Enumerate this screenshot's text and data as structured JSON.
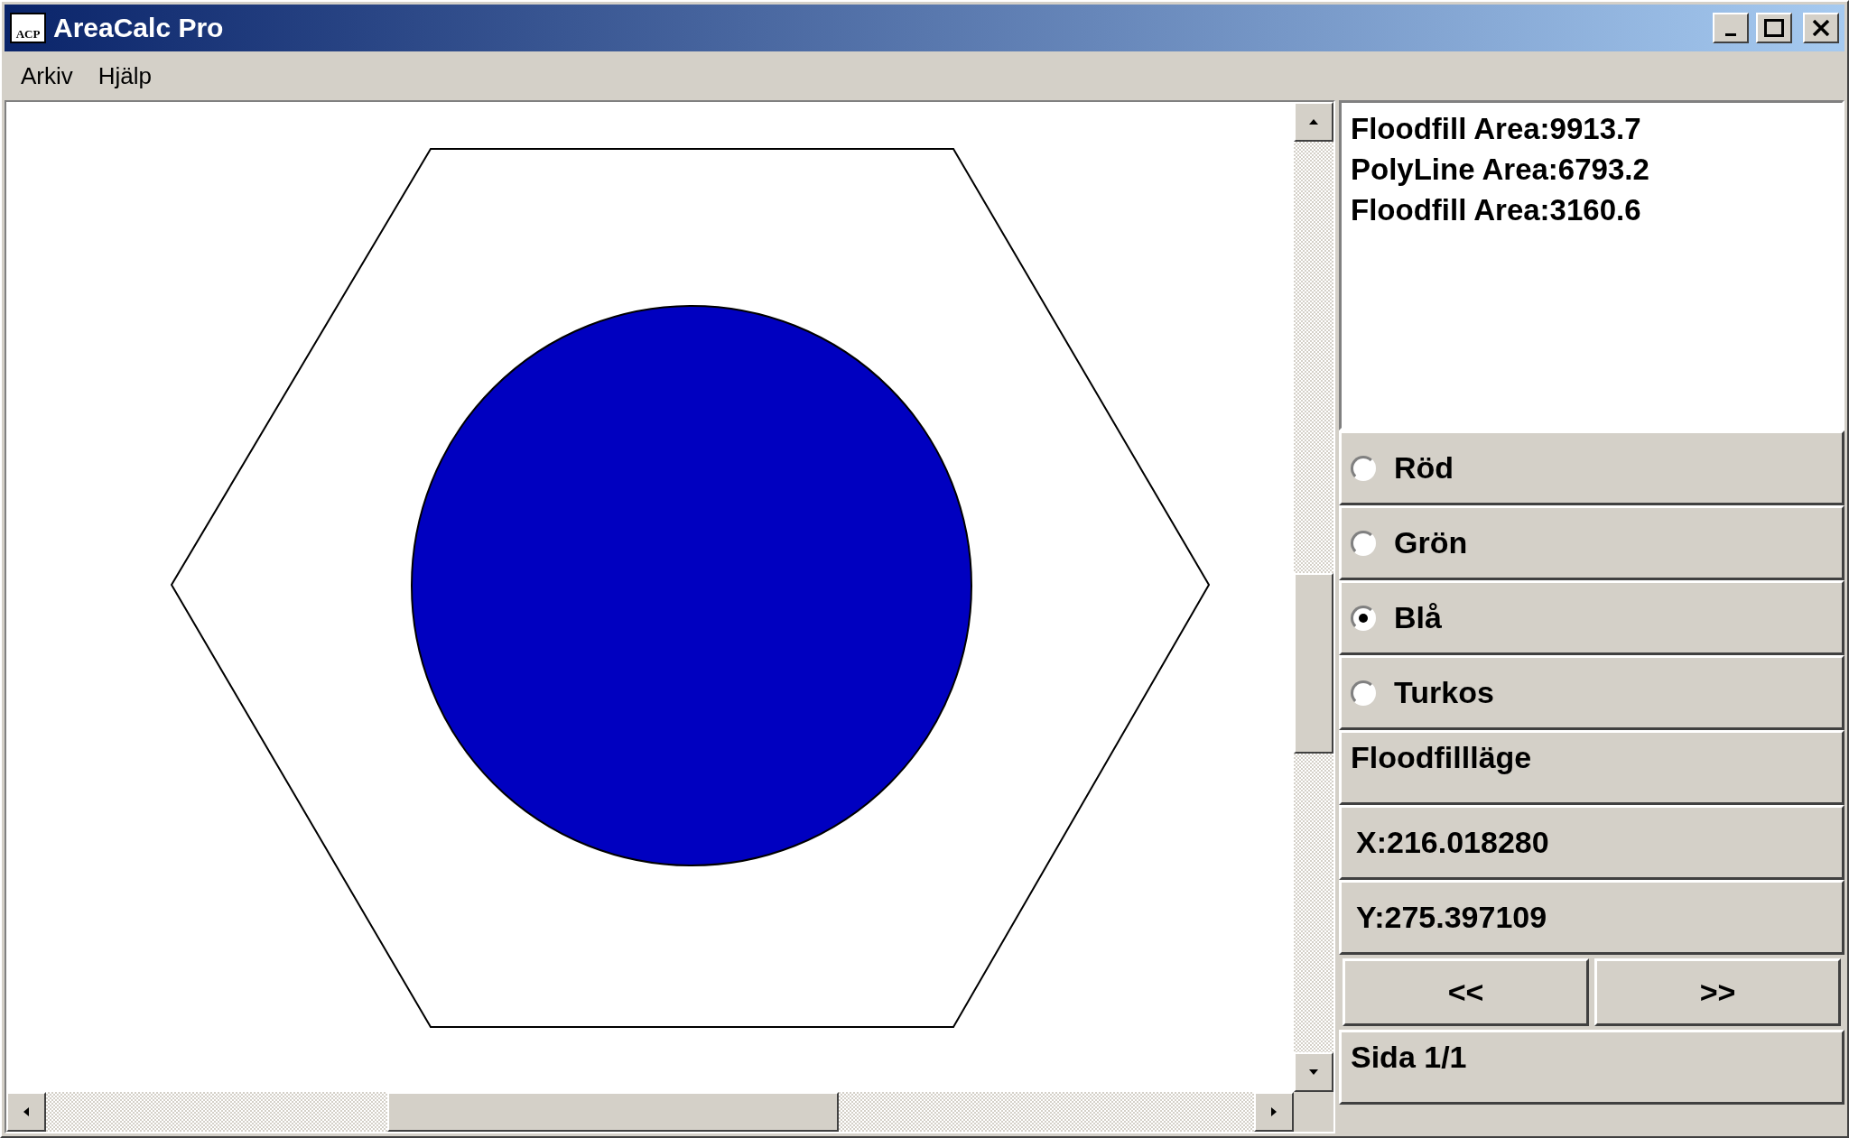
{
  "window": {
    "title": "AreaCalc Pro",
    "icon_text": "ACP"
  },
  "menu": [
    "Arkiv",
    "Hjälp"
  ],
  "results": [
    "Floodfill Area:9913.7",
    "PolyLine Area:6793.2",
    "Floodfill Area:3160.6"
  ],
  "colors": [
    {
      "label": "Röd",
      "selected": false
    },
    {
      "label": "Grön",
      "selected": false
    },
    {
      "label": "Blå",
      "selected": true
    },
    {
      "label": "Turkos",
      "selected": false
    }
  ],
  "mode": "Floodfillläge",
  "x_coord": "X:216.018280",
  "y_coord": "Y:275.397109",
  "pager": {
    "prev": "<<",
    "next": ">>",
    "page": "Sida 1/1"
  }
}
